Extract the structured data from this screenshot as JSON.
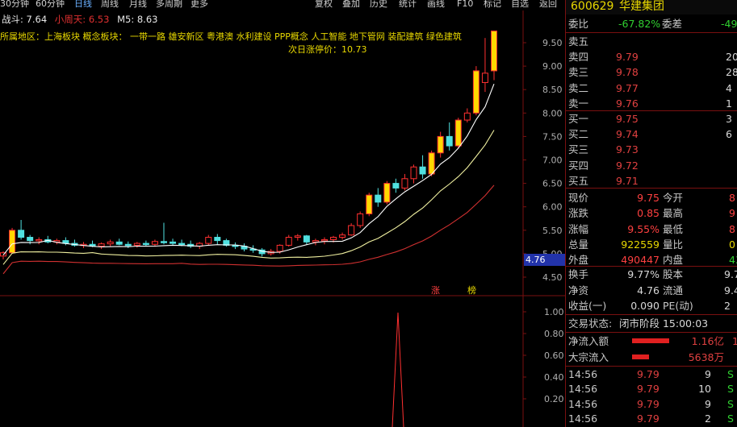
{
  "toolbar": {
    "left_items": [
      "30分钟",
      "60分钟",
      "日线",
      "周线",
      "月线",
      "多周期",
      "更多"
    ],
    "selected": "日线",
    "right_items": [
      "复权",
      "叠加",
      "历史",
      "统计",
      "画线",
      "F10",
      "标记",
      "自选",
      "返回"
    ]
  },
  "indicators": {
    "line1": [
      {
        "label": "战斗: 7.64",
        "color": "#e8e8e8"
      },
      {
        "label": "小周天: 6.53",
        "color": "#e03030"
      },
      {
        "label": "M5: 8.63",
        "color": "#e8e8e8"
      }
    ],
    "concepts": "所属地区：上海板块   概念板块：  一带一路  雄安新区  粤港澳  水利建设  PPP概念  人工智能  地下管网  装配建筑  绿色建筑",
    "next_limit": "次日涨停价：10.73"
  },
  "price_axis": {
    "ticks": [
      "9.50",
      "9.00",
      "8.50",
      "8.00",
      "7.50",
      "7.00",
      "6.50",
      "6.00",
      "5.50",
      "5.00",
      "4.50"
    ],
    "ticks_values": [
      9.5,
      9.0,
      8.5,
      8.0,
      7.5,
      7.0,
      6.5,
      6.0,
      5.5,
      5.0,
      4.5
    ],
    "current_marker": "4.76"
  },
  "volume_axis": {
    "ticks": [
      "1.00",
      "0.80",
      "0.60",
      "0.40",
      "0.20"
    ],
    "ticks_values": [
      1.0,
      0.8,
      0.6,
      0.4,
      0.2
    ]
  },
  "badges": [
    "涨",
    "榜"
  ],
  "chart_data": {
    "type": "candlestick",
    "ylim": [
      4.2,
      10.0
    ],
    "candles": [
      [
        4.95,
        5.05,
        4.88,
        5.02
      ],
      [
        5.02,
        5.55,
        5.0,
        5.5
      ],
      [
        5.5,
        5.72,
        5.3,
        5.35
      ],
      [
        5.35,
        5.4,
        5.2,
        5.28
      ],
      [
        5.28,
        5.35,
        5.2,
        5.3
      ],
      [
        5.3,
        5.38,
        5.22,
        5.25
      ],
      [
        5.25,
        5.32,
        5.2,
        5.28
      ],
      [
        5.28,
        5.35,
        5.18,
        5.22
      ],
      [
        5.22,
        5.3,
        5.15,
        5.18
      ],
      [
        5.18,
        5.25,
        5.12,
        5.2
      ],
      [
        5.2,
        5.28,
        5.14,
        5.16
      ],
      [
        5.16,
        5.24,
        5.1,
        5.21
      ],
      [
        5.21,
        5.3,
        5.16,
        5.25
      ],
      [
        5.25,
        5.32,
        5.18,
        5.2
      ],
      [
        5.2,
        5.26,
        5.12,
        5.18
      ],
      [
        5.18,
        5.25,
        5.13,
        5.22
      ],
      [
        5.22,
        5.28,
        5.16,
        5.2
      ],
      [
        5.2,
        5.3,
        5.15,
        5.26
      ],
      [
        5.26,
        5.66,
        5.2,
        5.25
      ],
      [
        5.25,
        5.32,
        5.18,
        5.22
      ],
      [
        5.22,
        5.3,
        5.16,
        5.2
      ],
      [
        5.2,
        5.28,
        5.12,
        5.16
      ],
      [
        5.16,
        5.25,
        5.1,
        5.22
      ],
      [
        5.22,
        5.4,
        5.18,
        5.35
      ],
      [
        5.35,
        5.42,
        5.2,
        5.28
      ],
      [
        5.28,
        5.32,
        5.15,
        5.18
      ],
      [
        5.18,
        5.24,
        5.1,
        5.16
      ],
      [
        5.16,
        5.22,
        5.05,
        5.1
      ],
      [
        5.1,
        5.18,
        5.02,
        5.08
      ],
      [
        5.08,
        5.12,
        4.94,
        5.0
      ],
      [
        5.0,
        5.1,
        4.96,
        5.05
      ],
      [
        5.05,
        5.2,
        5.0,
        5.18
      ],
      [
        5.18,
        5.4,
        5.15,
        5.35
      ],
      [
        5.35,
        5.42,
        5.28,
        5.38
      ],
      [
        5.38,
        5.4,
        5.2,
        5.25
      ],
      [
        5.25,
        5.32,
        5.18,
        5.28
      ],
      [
        5.28,
        5.35,
        5.2,
        5.3
      ],
      [
        5.3,
        5.38,
        5.24,
        5.35
      ],
      [
        5.35,
        5.45,
        5.3,
        5.4
      ],
      [
        5.4,
        5.65,
        5.38,
        5.6
      ],
      [
        5.6,
        5.9,
        5.55,
        5.85
      ],
      [
        5.85,
        6.3,
        5.8,
        6.25
      ],
      [
        6.25,
        6.4,
        6.0,
        6.1
      ],
      [
        6.1,
        6.55,
        6.05,
        6.5
      ],
      [
        6.5,
        6.6,
        6.3,
        6.4
      ],
      [
        6.4,
        6.7,
        6.35,
        6.6
      ],
      [
        6.6,
        6.9,
        6.5,
        6.85
      ],
      [
        6.85,
        7.1,
        6.6,
        6.7
      ],
      [
        6.7,
        7.2,
        6.65,
        7.15
      ],
      [
        7.15,
        7.6,
        7.05,
        7.5
      ],
      [
        7.5,
        7.8,
        7.2,
        7.3
      ],
      [
        7.3,
        7.9,
        7.25,
        7.85
      ],
      [
        7.85,
        8.1,
        7.8,
        8.0
      ],
      [
        8.0,
        9.0,
        7.95,
        8.9
      ],
      [
        8.65,
        9.6,
        8.45,
        8.85
      ],
      [
        8.9,
        9.75,
        8.7,
        9.75
      ]
    ]
  },
  "stock": {
    "code": "600629",
    "name": "华建集团"
  },
  "committee": {
    "ratio_label": "委比",
    "ratio_value": "-67.82%",
    "diff_label": "委差",
    "diff_value": "-49"
  },
  "asks": [
    {
      "label": "卖五",
      "price": "",
      "vol": ""
    },
    {
      "label": "卖四",
      "price": "9.79",
      "vol": "20"
    },
    {
      "label": "卖三",
      "price": "9.78",
      "vol": "28"
    },
    {
      "label": "卖二",
      "price": "9.77",
      "vol": "4"
    },
    {
      "label": "卖一",
      "price": "9.76",
      "vol": "1"
    }
  ],
  "bids": [
    {
      "label": "买一",
      "price": "9.75",
      "vol": "3"
    },
    {
      "label": "买二",
      "price": "9.74",
      "vol": "6"
    },
    {
      "label": "买三",
      "price": "9.73",
      "vol": ""
    },
    {
      "label": "买四",
      "price": "9.72",
      "vol": ""
    },
    {
      "label": "买五",
      "price": "9.71",
      "vol": ""
    }
  ],
  "quote": [
    {
      "l1": "现价",
      "v1": "9.75",
      "c1": "red",
      "l2": "今开",
      "v2": "8",
      "c2": "red"
    },
    {
      "l1": "涨跌",
      "v1": "0.85",
      "c1": "red",
      "l2": "最高",
      "v2": "9",
      "c2": "red"
    },
    {
      "l1": "涨幅",
      "v1": "9.55%",
      "c1": "red",
      "l2": "最低",
      "v2": "8",
      "c2": "red"
    },
    {
      "l1": "总量",
      "v1": "922559",
      "c1": "yel",
      "l2": "量比",
      "v2": "0",
      "c2": "yel"
    },
    {
      "l1": "外盘",
      "v1": "490447",
      "c1": "red",
      "l2": "内盘",
      "v2": "4323",
      "c2": "grn"
    }
  ],
  "fundamentals": [
    {
      "l1": "换手",
      "v1": "9.77%",
      "l2": "股本",
      "v2": "9.7"
    },
    {
      "l1": "净资",
      "v1": "4.76",
      "l2": "流通",
      "v2": "9.4"
    },
    {
      "l1": "收益(一)",
      "v1": "0.090",
      "l2": "PE(动)",
      "v2": "2"
    }
  ],
  "status": {
    "label": "交易状态:",
    "value": "闭市阶段 15:00:03"
  },
  "flows": [
    {
      "label": "净流入额",
      "value": "1.16亿",
      "extra": "1",
      "fill": 1.0
    },
    {
      "label": "大宗流入",
      "value": "5638万",
      "extra": "",
      "fill": 0.45
    }
  ],
  "ticks": [
    {
      "time": "14:56",
      "price": "9.79",
      "vol": "9",
      "side": "S"
    },
    {
      "time": "14:56",
      "price": "9.79",
      "vol": "10",
      "side": "S"
    },
    {
      "time": "14:56",
      "price": "9.79",
      "vol": "9",
      "side": "S"
    },
    {
      "time": "14:56",
      "price": "9.79",
      "vol": "2",
      "side": "S"
    }
  ]
}
